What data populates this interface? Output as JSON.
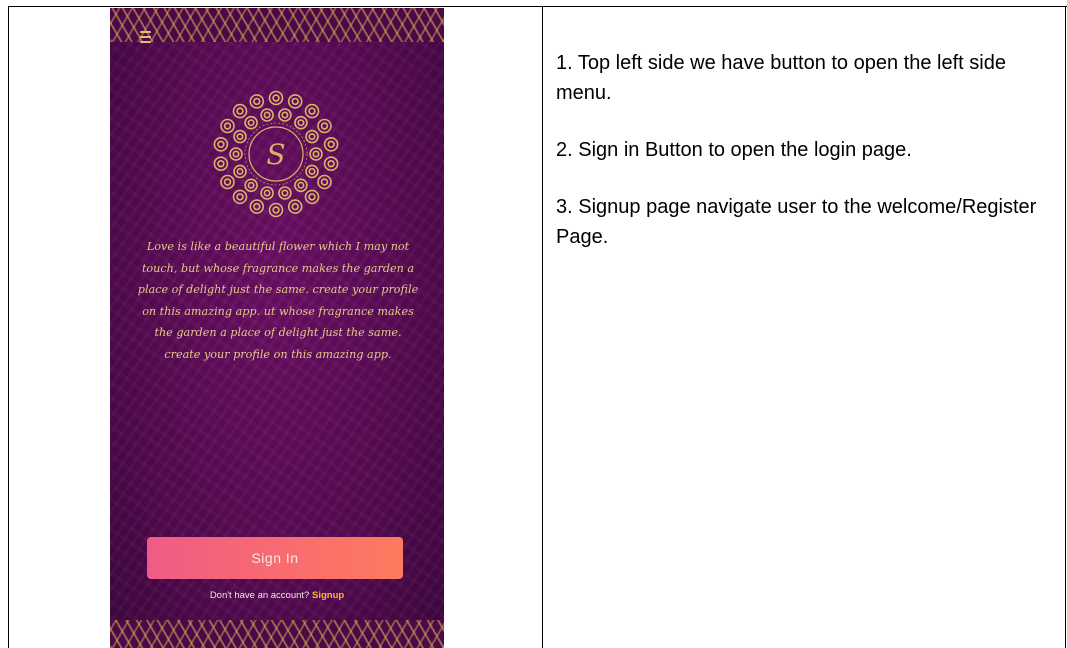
{
  "colors": {
    "accent_gold": "#e0c07a",
    "signin_gradient_start": "#f05b86",
    "signin_gradient_end": "#ff7a5e",
    "signup_link": "#ffb72c",
    "background_purple": "#560a52"
  },
  "app": {
    "menu_icon": "hamburger-menu-icon",
    "logo_icon": "mandala-monogram-icon",
    "logo_text": "S",
    "quote": "Love is like a beautiful flower which I may not touch, but whose fragrance makes the garden a place of delight just the same. create your profile on this amazing app. ut whose fragrance makes the garden a place of delight just the same. create your profile on this amazing app.",
    "signin_label": "Sign In",
    "signup_prompt": "Don't have an account?",
    "signup_label": "Signup"
  },
  "instructions": [
    "1. Top left side we have button to open the left side menu.",
    "2. Sign in Button to open the login page.",
    "3. Signup page navigate user to the welcome/Register Page."
  ]
}
